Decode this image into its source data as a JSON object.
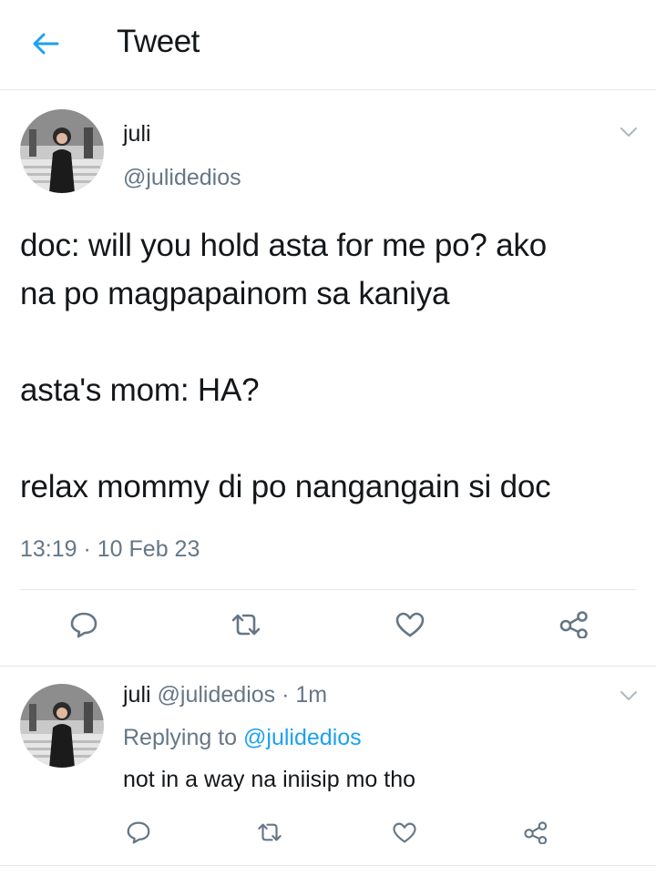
{
  "header": {
    "title": "Tweet",
    "back_icon": "arrow-left-icon",
    "accent": "#1da1f2"
  },
  "tweet": {
    "name": "juli",
    "handle": "@julidedios",
    "lines": [
      "doc: will you hold asta for me po? ako",
      "na po magpapainom sa kaniya",
      "",
      "asta's mom: HA?",
      "",
      "relax mommy di po nangangain si doc"
    ],
    "timestamp": "13:19 · 10 Feb 23",
    "actions": [
      "reply-icon",
      "retweet-icon",
      "like-icon",
      "share-icon"
    ]
  },
  "reply": {
    "name": "juli",
    "handle": "@julidedios",
    "time": "· 1m",
    "replying_prefix": "Replying to",
    "replying_to": "@julidedios",
    "text": "not in a way na iniisip mo tho",
    "actions": [
      "reply-icon",
      "retweet-icon",
      "like-icon",
      "share-icon"
    ]
  },
  "colors": {
    "text": "#14171a",
    "muted": "#657786",
    "icon": "#657786",
    "border": "#e1e8ed"
  }
}
